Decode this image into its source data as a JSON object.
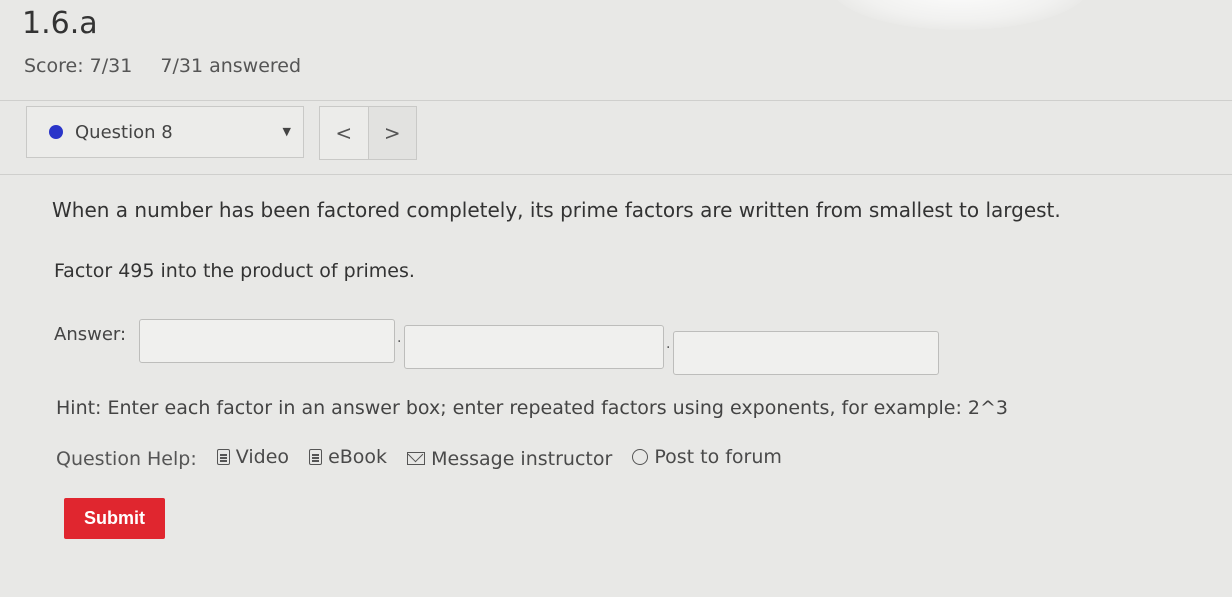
{
  "header": {
    "title": "1.6.a",
    "score": "Score: 7/31",
    "answered": "7/31 answered"
  },
  "question_nav": {
    "selected_question": "Question 8",
    "status_color": "#2a35c9",
    "prev_symbol": "<",
    "next_symbol": ">"
  },
  "question": {
    "stem": "When a number has been factored completely, its prime factors are written from smallest to largest.",
    "prompt": "Factor 495 into the product of primes.",
    "answer_label": "Answer:",
    "answer_boxes": [
      "",
      "",
      ""
    ],
    "separator": "·",
    "hint": "Hint: Enter each factor in an answer box; enter repeated factors using exponents, for example: 2^3"
  },
  "help": {
    "label": "Question Help:",
    "links": [
      {
        "label": "Video",
        "icon": "document-icon"
      },
      {
        "label": "eBook",
        "icon": "document-icon"
      },
      {
        "label": "Message instructor",
        "icon": "mail-icon"
      },
      {
        "label": "Post to forum",
        "icon": "forum-icon"
      }
    ]
  },
  "actions": {
    "submit_label": "Submit",
    "submit_color": "#e0262f"
  }
}
